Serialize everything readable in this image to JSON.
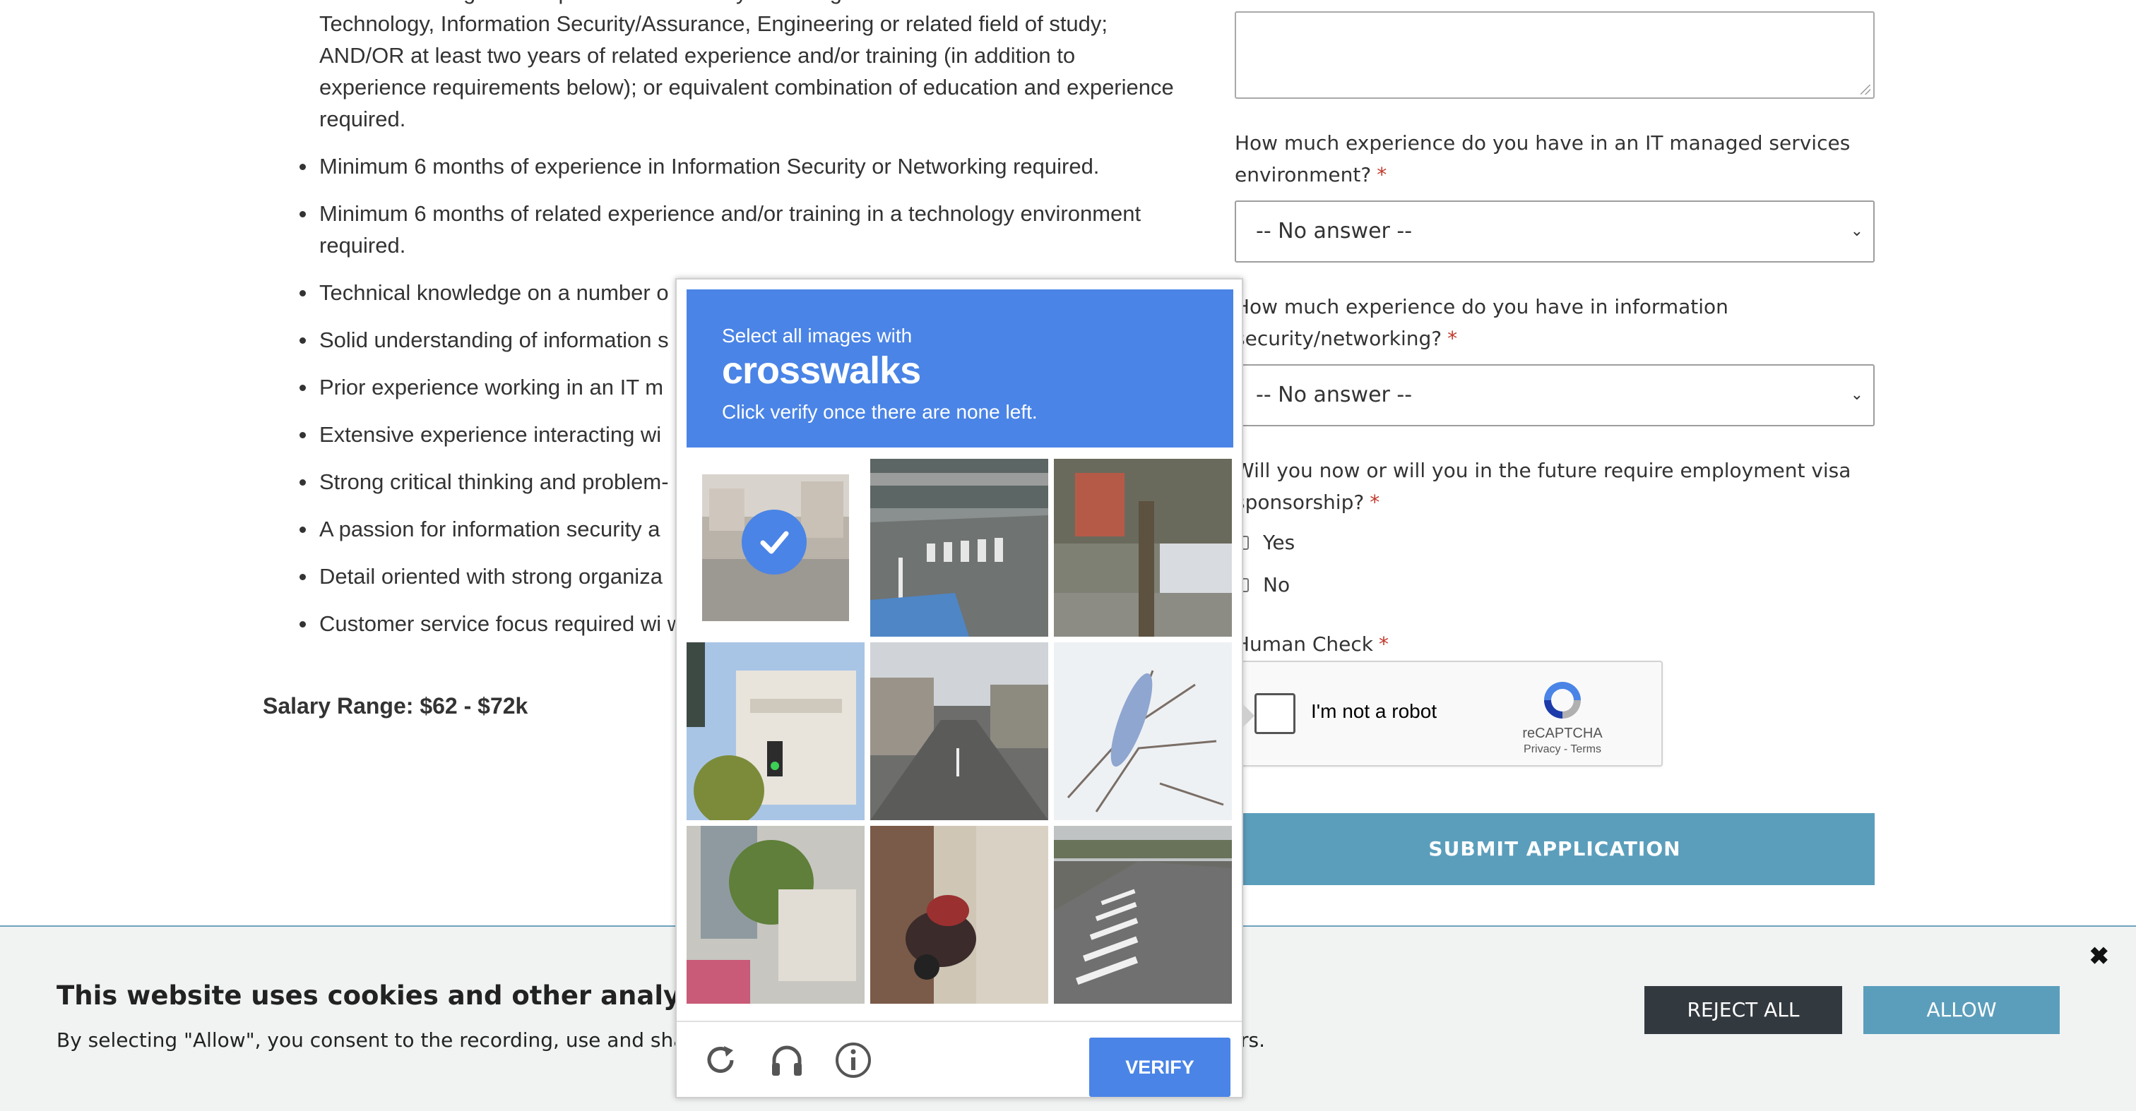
{
  "job": {
    "bullets": [
      "Associate's Degree or equivalent from two-year college or technical school in Information Technology, Information Security/Assurance, Engineering or related field of study; AND/OR at least two years of related experience and/or training (in addition to experience requirements below); or equivalent combination of education and experience required.",
      "Minimum 6 months of experience in Information Security or Networking required.",
      "Minimum 6 months of related experience and/or training in a technology environment required.",
      "Technical knowledge on a number o",
      "Solid understanding of information s",
      "Prior experience working in an IT m",
      "Extensive experience interacting wi",
      "Strong critical thinking and problem-",
      "A passion for information security a",
      "Detail oriented with strong organiza",
      "Customer service focus required wi written/verbal communication skills."
    ],
    "salary": "Salary Range: $62 - $72k"
  },
  "form": {
    "q_it_managed": "How much experience do you have in an IT managed services environment?",
    "q_infosec": "How much experience do you have in information security/networking?",
    "q_visa": "Will you now or will you in the future require employment visa sponsorship?",
    "required_mark": "*",
    "select_value": "-- No answer --",
    "visa_yes": "Yes",
    "visa_no": "No",
    "human_check": "Human Check",
    "recaptcha_label": "I'm not a robot",
    "recaptcha_brand": "reCAPTCHA",
    "recaptcha_terms": "Privacy - Terms",
    "submit": "SUBMIT APPLICATION"
  },
  "captcha": {
    "line1": "Select all images with",
    "target": "crosswalks",
    "line3": "Click verify once there are none left.",
    "verify": "VERIFY",
    "tiles": [
      {
        "desc": "street with building",
        "selected": true
      },
      {
        "desc": "road with crosswalk",
        "selected": false
      },
      {
        "desc": "car by tree",
        "selected": false
      },
      {
        "desc": "traffic light and building",
        "selected": false
      },
      {
        "desc": "street with shops",
        "selected": false
      },
      {
        "desc": "bare branches",
        "selected": false
      },
      {
        "desc": "storefront and tree",
        "selected": false
      },
      {
        "desc": "parked motorbikes",
        "selected": false
      },
      {
        "desc": "highway with crosswalk",
        "selected": false
      }
    ]
  },
  "cookie": {
    "title": "This website uses cookies and other analytics tech",
    "text": "By selecting \"Allow\", you consent to the recording, use and sharing",
    "text_tail": "rs.",
    "reject": "REJECT ALL",
    "allow": "ALLOW",
    "close": "✖"
  },
  "colors": {
    "captcha_blue": "#4a84e6",
    "submit_teal": "#5b9ebc",
    "reject_dark": "#333a3f",
    "required_red": "#c0392b"
  }
}
